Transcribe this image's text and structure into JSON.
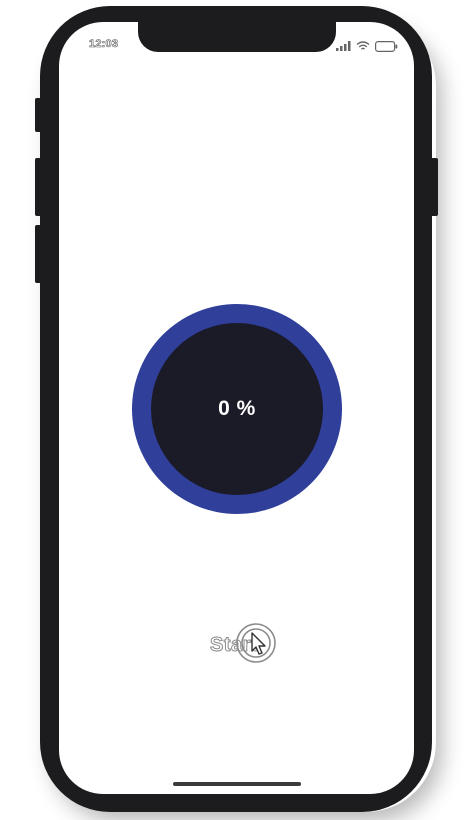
{
  "status_bar": {
    "time": "12:03",
    "signal_icon": "cellular-signal-icon",
    "wifi_icon": "wifi-icon",
    "battery_icon": "battery-icon"
  },
  "progress": {
    "value_percent": 0,
    "label": "0 %",
    "ring_color": "#2f3f9a",
    "inner_color": "#1b1a27"
  },
  "actions": {
    "start_label": "Start"
  },
  "overlay": {
    "touch_icon": "touch-indicator-icon"
  }
}
